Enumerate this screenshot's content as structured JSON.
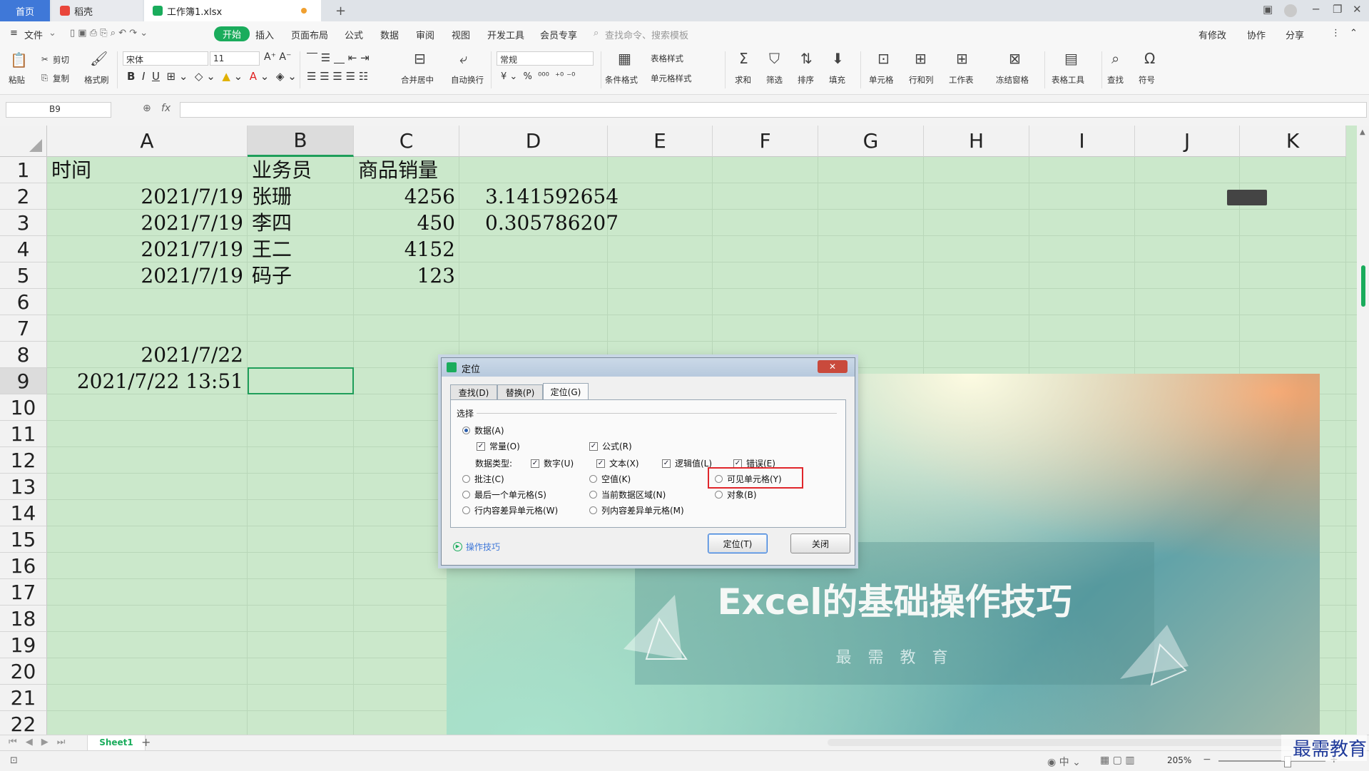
{
  "tabs": {
    "home": "首页",
    "docer": "稻壳",
    "book": "工作簿1.xlsx",
    "new_tab": "+"
  },
  "menu": {
    "file": "文件",
    "items": [
      "开始",
      "插入",
      "页面布局",
      "公式",
      "数据",
      "审阅",
      "视图",
      "开发工具",
      "会员专享"
    ],
    "search_placeholder": "查找命令、搜索模板",
    "modified": "有修改",
    "collab": "协作",
    "share": "分享"
  },
  "ribbon": {
    "paste": "粘贴",
    "cut": "剪切",
    "copy": "复制",
    "format_painter": "格式刷",
    "font": "宋体",
    "font_size": "11",
    "number_format": "常规",
    "merge": "合并居中",
    "wrap": "自动换行",
    "cond_format": "条件格式",
    "table_style": "表格样式",
    "cell_style": "单元格样式",
    "sum": "求和",
    "filter": "筛选",
    "sort": "排序",
    "fill": "填充",
    "cell": "单元格",
    "row_col": "行和列",
    "worksheet": "工作表",
    "freeze": "冻结窗格",
    "table_tools": "表格工具",
    "find": "查找",
    "symbol": "符号"
  },
  "formula_bar": {
    "name_box": "B9",
    "fx": "fx",
    "content": ""
  },
  "columns": [
    "A",
    "B",
    "C",
    "D",
    "E",
    "F",
    "G",
    "H",
    "I",
    "J",
    "K"
  ],
  "rows": [
    "1",
    "2",
    "3",
    "4",
    "5",
    "6",
    "7",
    "8",
    "9",
    "10",
    "11",
    "12",
    "13",
    "14",
    "15",
    "16",
    "17",
    "18",
    "19",
    "20",
    "21",
    "22"
  ],
  "cells": {
    "A1": "时间",
    "B1": "业务员",
    "C1": "商品销量",
    "A2": "2021/7/19",
    "B2": "张珊",
    "C2": "4256",
    "D2": "3.141592654",
    "A3": "2021/7/19",
    "B3": "李四",
    "C3": "450",
    "D3": "0.305786207",
    "A4": "2021/7/19",
    "B4": "王二",
    "C4": "4152",
    "A5": "2021/7/19",
    "B5": "码子",
    "C5": "123",
    "A8": "2021/7/22",
    "A9": "2021/7/22 13:51"
  },
  "dialog": {
    "title": "定位",
    "tabs": [
      "查找(D)",
      "替换(P)",
      "定位(G)"
    ],
    "group": "选择",
    "data": "数据(A)",
    "constant": "常量(O)",
    "formula": "公式(R)",
    "data_type": "数据类型:",
    "number": "数字(U)",
    "text": "文本(X)",
    "logical": "逻辑值(L)",
    "error": "错误(E)",
    "comment": "批注(C)",
    "blank": "空值(K)",
    "visible": "可见单元格(Y)",
    "last_cell": "最后一个单元格(S)",
    "current_region": "当前数据区域(N)",
    "object": "对象(B)",
    "row_diff": "行内容差异单元格(W)",
    "col_diff": "列内容差异单元格(M)",
    "tips": "操作技巧",
    "ok": "定位(T)",
    "close": "关闭"
  },
  "promo": {
    "title": "Excel的基础操作技巧",
    "subtitle": "最 需 教 育"
  },
  "sheet_tab": "Sheet1",
  "status": {
    "zoom": "205%"
  },
  "watermark": "最需教育",
  "colors": {
    "accent": "#1aac5c",
    "grid_bg": "#cbe8cb",
    "highlight": "#e0262b"
  }
}
